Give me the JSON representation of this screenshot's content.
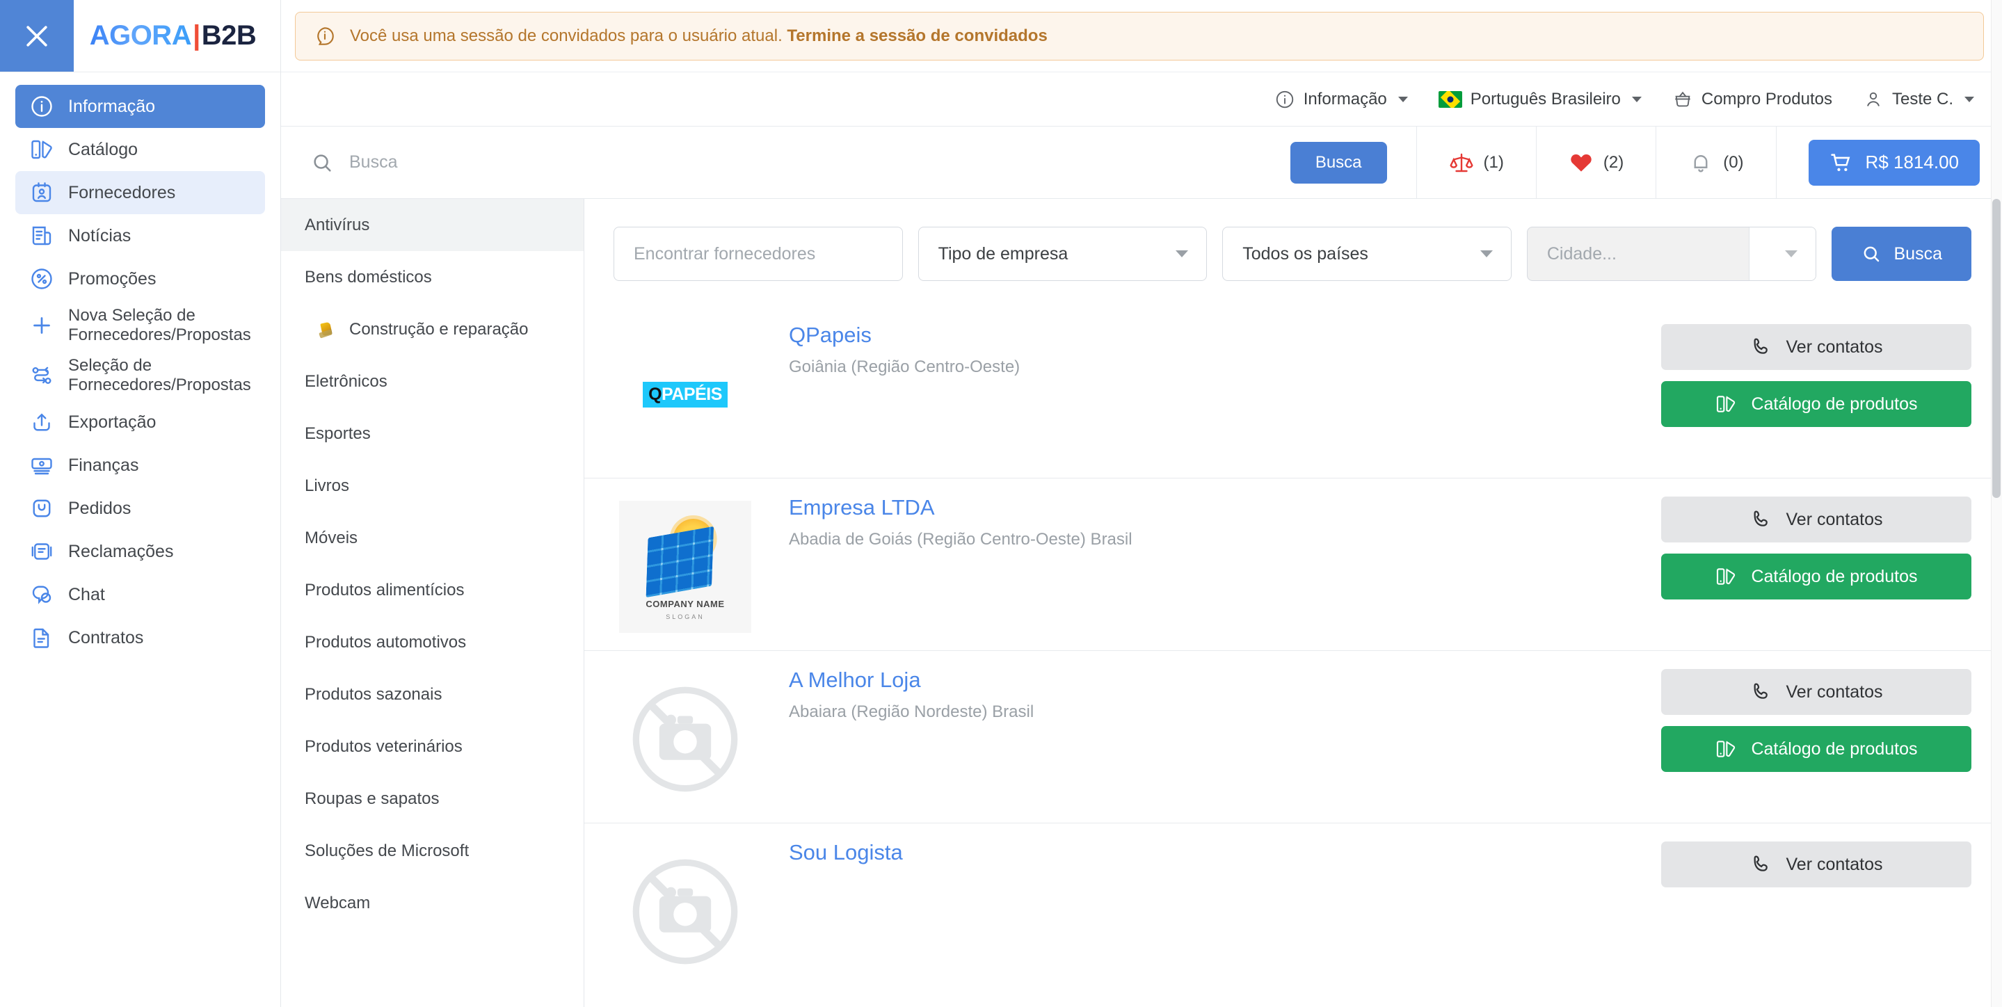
{
  "brand": {
    "part1": "AGORA",
    "divider": "|",
    "part2": "B2B"
  },
  "banner": {
    "icon": "info-circle-icon",
    "text_prefix": "Você usa uma sessão de convidados para o usuário atual.",
    "link_text": "Termine a sessão de convidados",
    "bg": "#fdf5ec",
    "border": "#f3c998",
    "fg": "#b4762c"
  },
  "sidebar": {
    "close_icon": "close-icon",
    "items": [
      {
        "label": "Informação",
        "icon": "info-icon",
        "state": "active"
      },
      {
        "label": "Catálogo",
        "icon": "catalog-icon",
        "state": "default"
      },
      {
        "label": "Fornecedores",
        "icon": "suppliers-icon",
        "state": "selected"
      },
      {
        "label": "Notícias",
        "icon": "news-icon",
        "state": "default"
      },
      {
        "label": "Promoções",
        "icon": "percent-icon",
        "state": "default"
      },
      {
        "label": "Nova Seleção de Fornecedores/Propostas",
        "icon": "plus-icon",
        "state": "default"
      },
      {
        "label": "Seleção de Fornecedores/Propostas",
        "icon": "shuffle-icon",
        "state": "default"
      },
      {
        "label": "Exportação",
        "icon": "upload-icon",
        "state": "default"
      },
      {
        "label": "Finanças",
        "icon": "money-icon",
        "state": "default"
      },
      {
        "label": "Pedidos",
        "icon": "bag-icon",
        "state": "default"
      },
      {
        "label": "Reclamações",
        "icon": "complaint-icon",
        "state": "default"
      },
      {
        "label": "Chat",
        "icon": "chat-icon",
        "state": "default"
      },
      {
        "label": "Contratos",
        "icon": "contract-icon",
        "state": "default"
      }
    ]
  },
  "utility_nav": {
    "info": {
      "label": "Informação",
      "icon": "info-circle-icon",
      "has_caret": true
    },
    "language": {
      "label": "Português Brasileiro",
      "icon": "brazil-flag-icon",
      "has_caret": true
    },
    "buy_products": {
      "label": "Compro Produtos",
      "icon": "basket-icon",
      "has_caret": false
    },
    "account": {
      "label": "Teste C.",
      "icon": "user-icon",
      "has_caret": true
    }
  },
  "search": {
    "placeholder": "Busca",
    "value": "",
    "icon": "search-icon",
    "button_label": "Busca",
    "counters": [
      {
        "name": "compare",
        "icon": "scales-icon",
        "value": "(1)",
        "color": "#e53935"
      },
      {
        "name": "favorites",
        "icon": "heart-icon",
        "value": "(2)",
        "color": "#e53935"
      },
      {
        "name": "notifications",
        "icon": "bell-icon",
        "value": "(0)",
        "color": "#9aa0a6"
      }
    ],
    "cart": {
      "icon": "cart-icon",
      "label": "R$ 1814.00",
      "color": "#4a86e8"
    }
  },
  "categories": [
    {
      "label": "Antivírus",
      "active": true,
      "sub": false
    },
    {
      "label": "Bens domésticos",
      "active": false,
      "sub": false
    },
    {
      "label": "Construção e reparação",
      "active": false,
      "sub": true
    },
    {
      "label": "Eletrônicos",
      "active": false,
      "sub": false
    },
    {
      "label": "Esportes",
      "active": false,
      "sub": false
    },
    {
      "label": "Livros",
      "active": false,
      "sub": false
    },
    {
      "label": "Móveis",
      "active": false,
      "sub": false
    },
    {
      "label": "Produtos alimentícios",
      "active": false,
      "sub": false
    },
    {
      "label": "Produtos automotivos",
      "active": false,
      "sub": false
    },
    {
      "label": "Produtos sazonais",
      "active": false,
      "sub": false
    },
    {
      "label": "Produtos veterinários",
      "active": false,
      "sub": false
    },
    {
      "label": "Roupas e sapatos",
      "active": false,
      "sub": false
    },
    {
      "label": "Soluções de Microsoft",
      "active": false,
      "sub": false
    },
    {
      "label": "Webcam",
      "active": false,
      "sub": false
    }
  ],
  "filters": {
    "find_placeholder": "Encontrar fornecedores",
    "find_value": "",
    "company_type": "Tipo de empresa",
    "country": "Todos os países",
    "city_placeholder": "Cidade...",
    "city_disabled": true,
    "search_button": "Busca",
    "search_icon": "search-icon"
  },
  "actions": {
    "contacts_label": "Ver contatos",
    "contacts_icon": "phone-icon",
    "catalog_label": "Catálogo de produtos",
    "catalog_icon": "catalog-icon",
    "catalog_color": "#22a861"
  },
  "suppliers": [
    {
      "name": "QPapeis",
      "location": "Goiânia (Região Centro-Oeste)",
      "logo_type": "qpapeis-logo",
      "logo_text_q": "Q",
      "logo_text_rest": "PAPÉIS"
    },
    {
      "name": "Empresa LTDA",
      "location": "Abadia de Goiás (Região Centro-Oeste) Brasil",
      "logo_type": "empresa-logo",
      "logo_company_name": "COMPANY NAME",
      "logo_slogan": "SLOGAN"
    },
    {
      "name": "A Melhor Loja",
      "location": "Abaiara (Região Nordeste) Brasil",
      "logo_type": "no-image-placeholder"
    },
    {
      "name": "Sou Logista",
      "location": "",
      "logo_type": "no-image-placeholder"
    }
  ]
}
